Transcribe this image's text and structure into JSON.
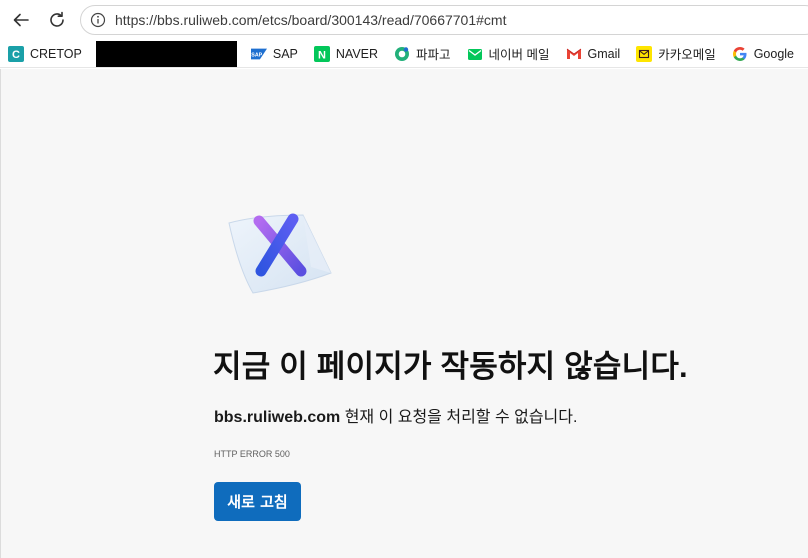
{
  "toolbar": {
    "url": "https://bbs.ruliweb.com/etcs/board/300143/read/70667701#cmt"
  },
  "bookmarks": [
    {
      "label": "CRETOP",
      "icon": "cretop-icon",
      "color": "#1aa0a8"
    },
    {
      "label": "SAP",
      "icon": "sap-icon",
      "color": "#1e6fd0"
    },
    {
      "label": "NAVER",
      "icon": "naver-icon",
      "color": "#03c75a"
    },
    {
      "label": "파파고",
      "icon": "papago-icon",
      "color": "#22b07a"
    },
    {
      "label": "네이버 메일",
      "icon": "naver-mail-icon",
      "color": "#03c75a"
    },
    {
      "label": "Gmail",
      "icon": "gmail-icon",
      "color": "#ea4335"
    },
    {
      "label": "카카오메일",
      "icon": "kakao-mail-icon",
      "color": "#fee500"
    },
    {
      "label": "Google",
      "icon": "google-icon",
      "color": "#4285f4"
    }
  ],
  "error": {
    "title": "지금 이 페이지가 작동하지 않습니다.",
    "host": "bbs.ruliweb.com",
    "message": " 현재 이 요청을 처리할 수 없습니다.",
    "code": "HTTP ERROR 500",
    "reload_label": "새로 고침"
  },
  "colors": {
    "accent": "#0f6cbd",
    "content_bg": "#f7f7f7"
  }
}
